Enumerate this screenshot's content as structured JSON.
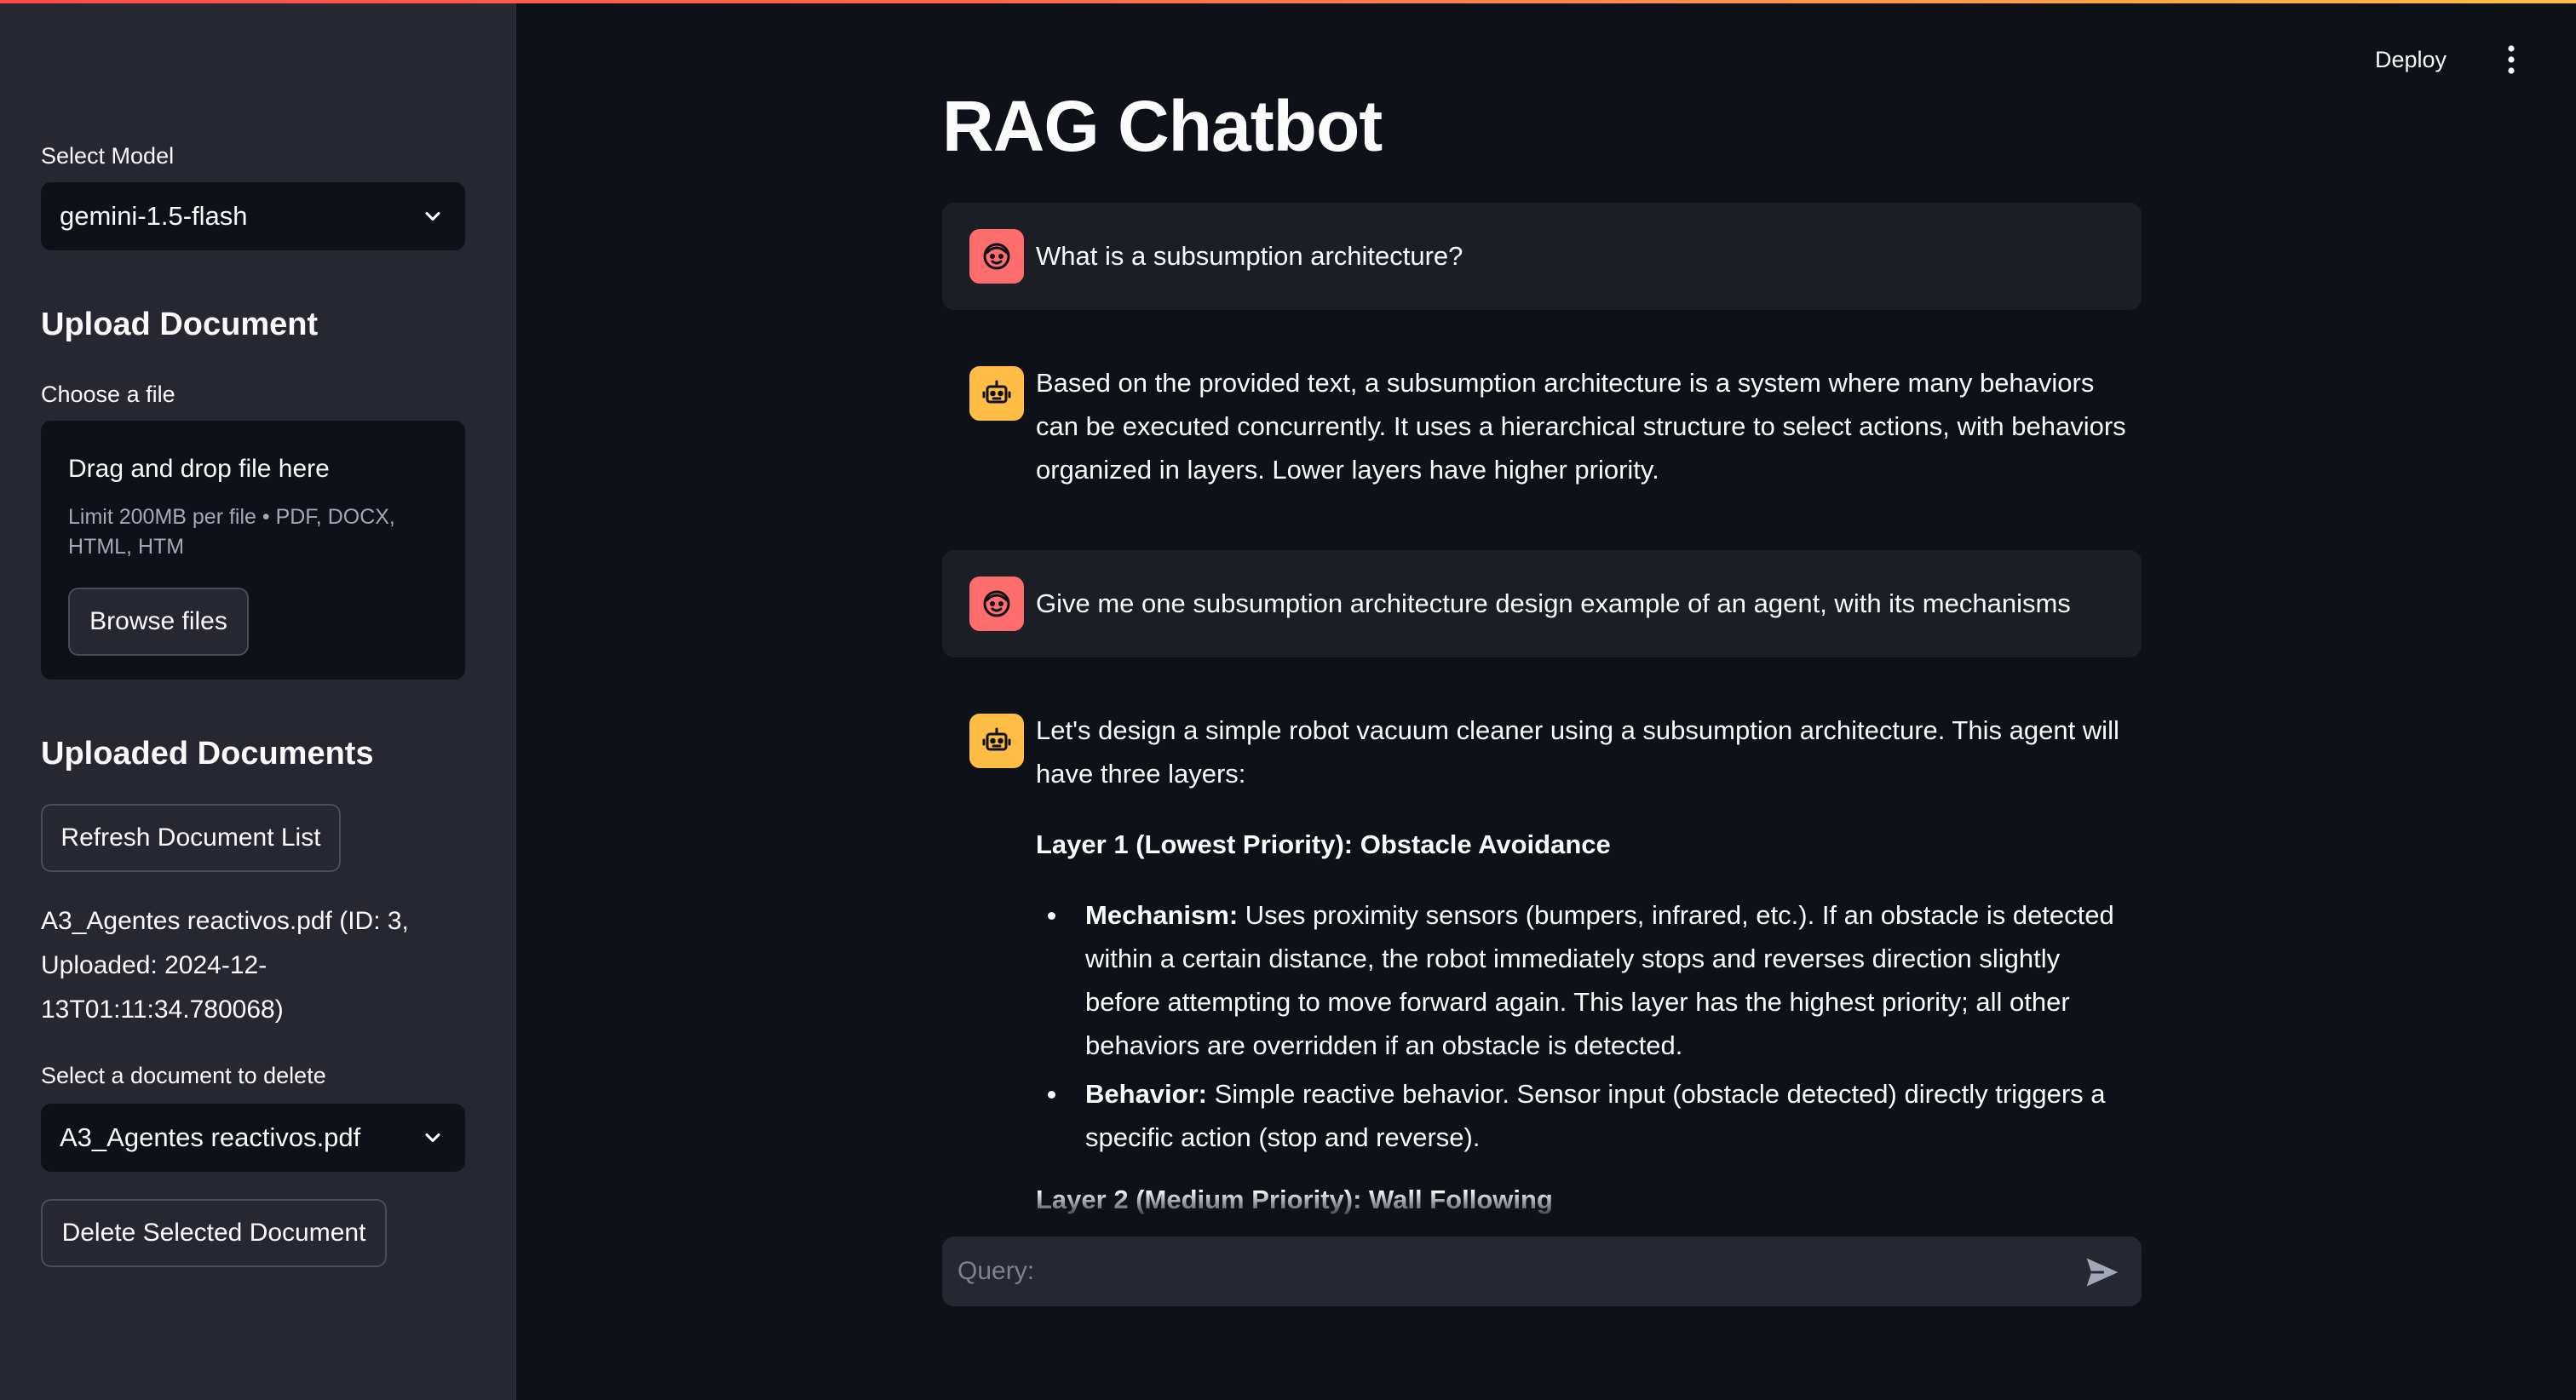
{
  "sidebar": {
    "model_label": "Select Model",
    "model_value": "gemini-1.5-flash",
    "upload_heading": "Upload Document",
    "file_label": "Choose a file",
    "dropzone_title": "Drag and drop file here",
    "dropzone_limit": "Limit 200MB per file • PDF, DOCX, HTML, HTM",
    "browse_label": "Browse files",
    "uploaded_heading": "Uploaded Documents",
    "refresh_label": "Refresh Document List",
    "doc_entry": "A3_Agentes reactivos.pdf (ID: 3, Uploaded: 2024-12-13T01:11:34.780068)",
    "delete_select_label": "Select a document to delete",
    "delete_select_value": "A3_Agentes reactivos.pdf",
    "delete_button_label": "Delete Selected Document"
  },
  "header": {
    "deploy_label": "Deploy"
  },
  "main": {
    "title": "RAG Chatbot",
    "messages": [
      {
        "role": "user",
        "text": "What is a subsumption architecture?"
      },
      {
        "role": "assistant",
        "text": "Based on the provided text, a subsumption architecture is a system where many behaviors can be executed concurrently. It uses a hierarchical structure to select actions, with behaviors organized in layers. Lower layers have higher priority."
      },
      {
        "role": "user",
        "text": "Give me one subsumption architecture design example of an agent, with its mechanisms"
      },
      {
        "role": "assistant",
        "intro": "Let's design a simple robot vacuum cleaner using a subsumption architecture. This agent will have three layers:",
        "layer1_heading": "Layer 1 (Lowest Priority): Obstacle Avoidance",
        "bullets": [
          {
            "label": "Mechanism:",
            "text": " Uses proximity sensors (bumpers, infrared, etc.). If an obstacle is detected within a certain distance, the robot immediately stops and reverses direction slightly before attempting to move forward again. This layer has the highest priority; all other behaviors are overridden if an obstacle is detected."
          },
          {
            "label": "Behavior:",
            "text": " Simple reactive behavior. Sensor input (obstacle detected) directly triggers a specific action (stop and reverse)."
          }
        ],
        "layer2_heading": "Layer 2 (Medium Priority): Wall Following"
      }
    ]
  },
  "chat_input": {
    "placeholder": "Query:"
  },
  "colors": {
    "background": "#0e1117",
    "sidebar": "#262730",
    "user_avatar": "#ff6c6c",
    "bot_avatar": "#ffbd45"
  }
}
